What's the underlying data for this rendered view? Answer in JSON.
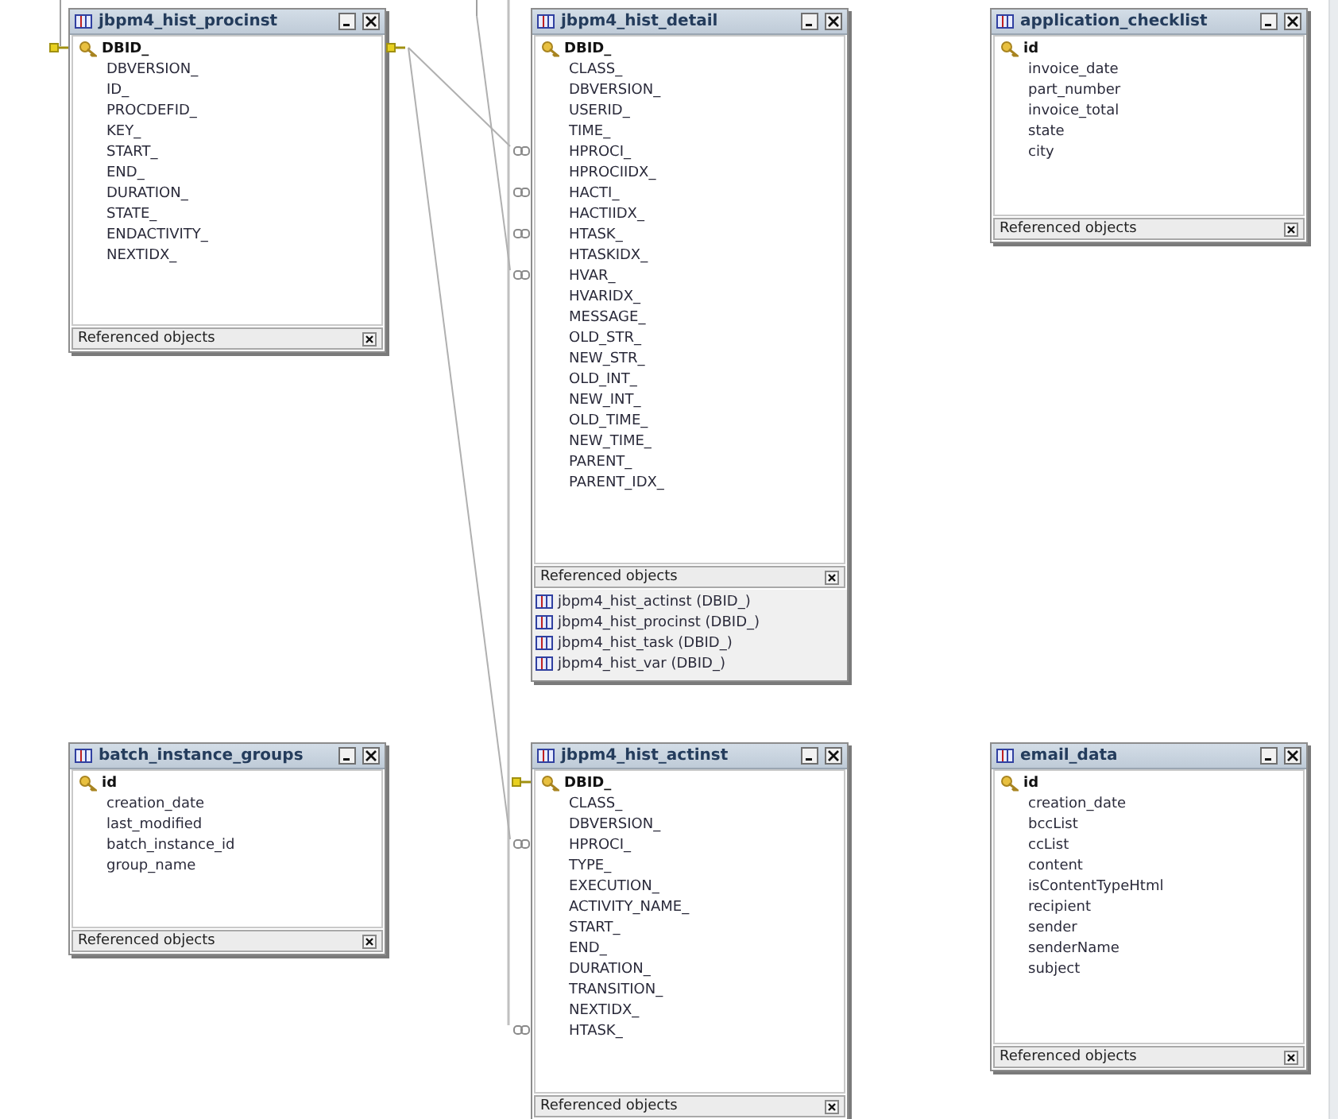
{
  "tables": [
    {
      "name": "jbpm4_hist_procinst",
      "fields": [
        {
          "name": "DBID_",
          "primary": true,
          "key_connector_left": true,
          "key_connector_right": true
        },
        {
          "name": "DBVERSION_"
        },
        {
          "name": "ID_"
        },
        {
          "name": "PROCDEFID_"
        },
        {
          "name": "KEY_"
        },
        {
          "name": "START_"
        },
        {
          "name": "END_"
        },
        {
          "name": "DURATION_"
        },
        {
          "name": "STATE_"
        },
        {
          "name": "ENDACTIVITY_"
        },
        {
          "name": "NEXTIDX_"
        }
      ],
      "references_label": "Referenced objects"
    },
    {
      "name": "jbpm4_hist_detail",
      "fields": [
        {
          "name": "DBID_",
          "primary": true
        },
        {
          "name": "CLASS_"
        },
        {
          "name": "DBVERSION_"
        },
        {
          "name": "USERID_"
        },
        {
          "name": "TIME_"
        },
        {
          "name": "HPROCI_",
          "link_connector": true
        },
        {
          "name": "HPROCIIDX_"
        },
        {
          "name": "HACTI_",
          "link_connector": true
        },
        {
          "name": "HACTIIDX_"
        },
        {
          "name": "HTASK_",
          "link_connector": true
        },
        {
          "name": "HTASKIDX_"
        },
        {
          "name": "HVAR_",
          "link_connector": true
        },
        {
          "name": "HVARIDX_"
        },
        {
          "name": "MESSAGE_"
        },
        {
          "name": "OLD_STR_"
        },
        {
          "name": "NEW_STR_"
        },
        {
          "name": "OLD_INT_"
        },
        {
          "name": "NEW_INT_"
        },
        {
          "name": "OLD_TIME_"
        },
        {
          "name": "NEW_TIME_"
        },
        {
          "name": "PARENT_"
        },
        {
          "name": "PARENT_IDX_"
        }
      ],
      "references_label": "Referenced objects",
      "references": [
        "jbpm4_hist_actinst (DBID_)",
        "jbpm4_hist_procinst (DBID_)",
        "jbpm4_hist_task (DBID_)",
        "jbpm4_hist_var (DBID_)"
      ]
    },
    {
      "name": "application_checklist",
      "fields": [
        {
          "name": "id",
          "primary": true
        },
        {
          "name": "invoice_date"
        },
        {
          "name": "part_number"
        },
        {
          "name": "invoice_total"
        },
        {
          "name": "state"
        },
        {
          "name": "city"
        }
      ],
      "references_label": "Referenced objects"
    },
    {
      "name": "batch_instance_groups",
      "fields": [
        {
          "name": "id",
          "primary": true
        },
        {
          "name": "creation_date"
        },
        {
          "name": "last_modified"
        },
        {
          "name": "batch_instance_id"
        },
        {
          "name": "group_name"
        }
      ],
      "references_label": "Referenced objects"
    },
    {
      "name": "jbpm4_hist_actinst",
      "fields": [
        {
          "name": "DBID_",
          "primary": true,
          "key_connector_left": true
        },
        {
          "name": "CLASS_"
        },
        {
          "name": "DBVERSION_"
        },
        {
          "name": "HPROCI_",
          "link_connector": true
        },
        {
          "name": "TYPE_"
        },
        {
          "name": "EXECUTION_"
        },
        {
          "name": "ACTIVITY_NAME_"
        },
        {
          "name": "START_"
        },
        {
          "name": "END_"
        },
        {
          "name": "DURATION_"
        },
        {
          "name": "TRANSITION_"
        },
        {
          "name": "NEXTIDX_"
        },
        {
          "name": "HTASK_",
          "link_connector": true
        }
      ],
      "references_label": "Referenced objects"
    },
    {
      "name": "email_data",
      "fields": [
        {
          "name": "id",
          "primary": true
        },
        {
          "name": "creation_date"
        },
        {
          "name": "bccList"
        },
        {
          "name": "ccList"
        },
        {
          "name": "content"
        },
        {
          "name": "isContentTypeHtml"
        },
        {
          "name": "recipient"
        },
        {
          "name": "sender"
        },
        {
          "name": "senderName"
        },
        {
          "name": "subject"
        }
      ],
      "references_label": "Referenced objects"
    }
  ]
}
